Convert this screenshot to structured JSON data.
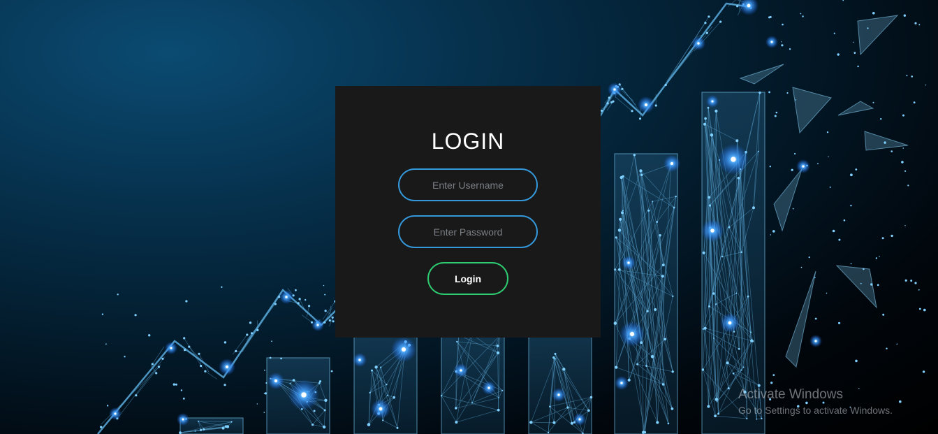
{
  "login": {
    "title": "LOGIN",
    "username_placeholder": "Enter Username",
    "password_placeholder": "Enter Password",
    "button_label": "Login"
  },
  "watermark": {
    "title": "Activate Windows",
    "subtitle": "Go to Settings to activate Windows."
  },
  "colors": {
    "card_background": "#191919",
    "input_border": "#3498db",
    "button_border": "#2ecc71",
    "glow": "#4aa8ff"
  }
}
